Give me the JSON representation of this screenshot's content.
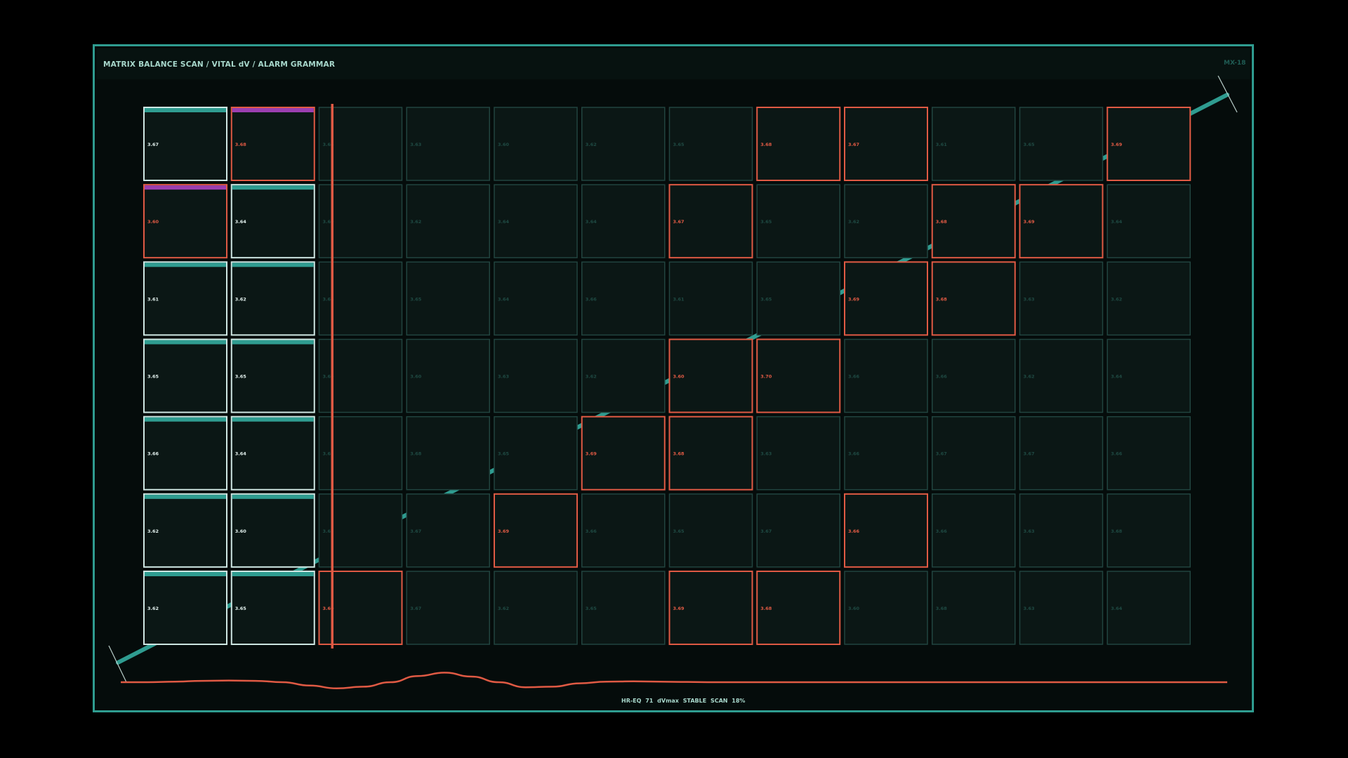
{
  "header": {
    "title": "MATRIX BALANCE SCAN / VITAL dV / ALARM GRAMMAR",
    "tag": "MX-18"
  },
  "footer": {
    "status": "HR-EQ 71  dVmax STABLE  SCAN 18%"
  },
  "colors": {
    "accent": "#2f9c90",
    "alarm": "#e05a44",
    "magenta": "#9b3fb0",
    "checked": "#cfe7e3",
    "idle": "#21443f",
    "cell_bg": "#0b1715"
  },
  "scan": {
    "progress_percent": 18,
    "scanned_columns": 2
  },
  "matrix": {
    "rows": [
      [
        "3.67",
        "3.68",
        "3.64",
        "3.63",
        "3.60",
        "3.62",
        "3.65",
        "3.68",
        "3.67",
        "3.61",
        "3.65",
        "3.69"
      ],
      [
        "3.60",
        "3.64",
        "3.60",
        "3.62",
        "3.64",
        "3.64",
        "3.67",
        "3.65",
        "3.62",
        "3.68",
        "3.69",
        "3.64"
      ],
      [
        "3.61",
        "3.62",
        "3.64",
        "3.65",
        "3.64",
        "3.66",
        "3.61",
        "3.65",
        "3.69",
        "3.68",
        "3.63",
        "3.62"
      ],
      [
        "3.65",
        "3.65",
        "3.60",
        "3.60",
        "3.63",
        "3.62",
        "3.60",
        "3.70",
        "3.66",
        "3.66",
        "3.62",
        "3.64"
      ],
      [
        "3.66",
        "3.64",
        "3.61",
        "3.68",
        "3.65",
        "3.69",
        "3.68",
        "3.63",
        "3.66",
        "3.67",
        "3.67",
        "3.66"
      ],
      [
        "3.62",
        "3.60",
        "3.63",
        "3.67",
        "3.69",
        "3.66",
        "3.65",
        "3.67",
        "3.66",
        "3.66",
        "3.63",
        "3.68"
      ],
      [
        "3.62",
        "3.65",
        "3.60",
        "3.67",
        "3.62",
        "3.65",
        "3.69",
        "3.68",
        "3.60",
        "3.68",
        "3.63",
        "3.64"
      ]
    ],
    "alarms": [
      [
        0,
        1
      ],
      [
        0,
        7
      ],
      [
        0,
        8
      ],
      [
        0,
        11
      ],
      [
        1,
        0
      ],
      [
        1,
        6
      ],
      [
        1,
        9
      ],
      [
        1,
        10
      ],
      [
        2,
        8
      ],
      [
        2,
        9
      ],
      [
        3,
        6
      ],
      [
        3,
        7
      ],
      [
        4,
        5
      ],
      [
        4,
        6
      ],
      [
        5,
        4
      ],
      [
        5,
        8
      ],
      [
        6,
        2
      ],
      [
        6,
        6
      ],
      [
        6,
        7
      ]
    ],
    "magenta_bars": [
      [
        0,
        1
      ],
      [
        1,
        0
      ]
    ]
  },
  "waveform": {
    "y": [
      0,
      0,
      0.05,
      0.12,
      0.15,
      0.12,
      0,
      -0.3,
      -0.55,
      -0.4,
      0,
      0.55,
      0.85,
      0.5,
      0,
      -0.45,
      -0.4,
      -0.1,
      0.05,
      0.08,
      0.05,
      0.02,
      0,
      0,
      0,
      0,
      0,
      0,
      0,
      0,
      0,
      0,
      0,
      0,
      0,
      0,
      0,
      0,
      0,
      0,
      0,
      0
    ]
  }
}
